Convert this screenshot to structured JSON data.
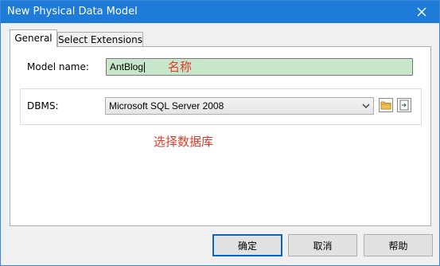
{
  "window": {
    "title": "New Physical Data Model"
  },
  "tabs": [
    {
      "label": "General",
      "active": true
    },
    {
      "label": "Select Extensions",
      "active": false
    }
  ],
  "general": {
    "model_name_label": "Model name:",
    "model_name_value": "AntBlog",
    "dbms_label": "DBMS:",
    "dbms_value": "Microsoft SQL Server 2008"
  },
  "annotations": {
    "name_note": "名称",
    "db_note": "选择数据库"
  },
  "buttons": {
    "ok": "确定",
    "cancel": "取消",
    "help": "帮助"
  },
  "colors": {
    "titlebar": "#1e7bd8",
    "annotation": "#e03a2a",
    "input_highlight": "#c8e6c9"
  },
  "icons": [
    "close-icon",
    "chevron-down-icon",
    "folder-icon",
    "properties-icon"
  ]
}
